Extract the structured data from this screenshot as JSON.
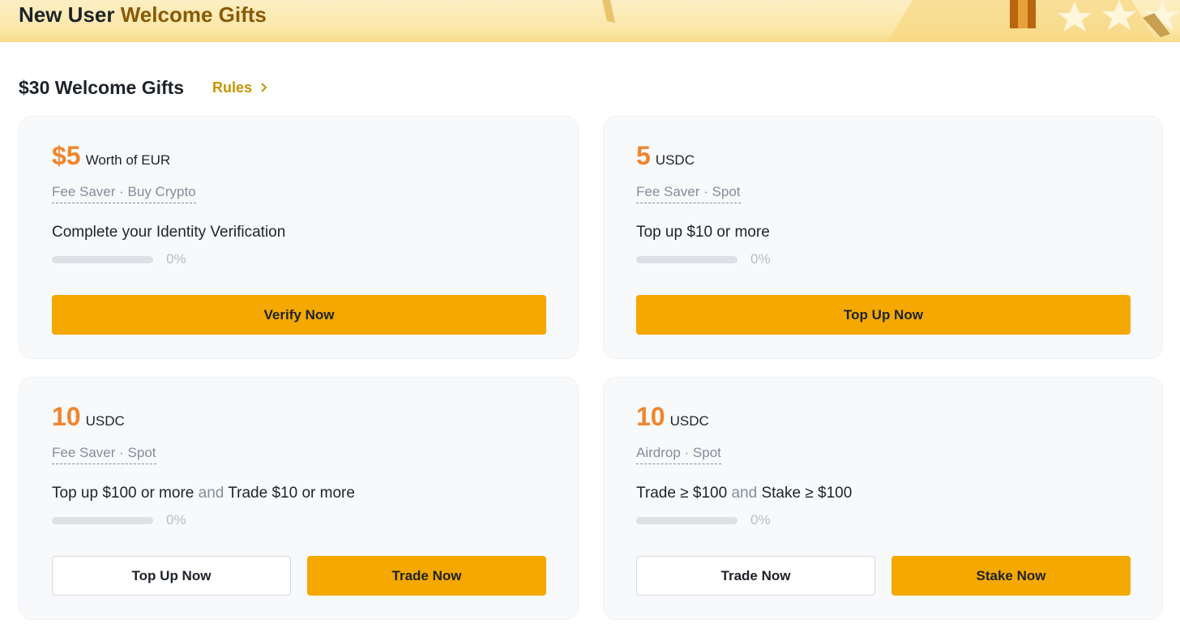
{
  "banner": {
    "title_prefix": "New User",
    "title_accent": "Welcome Gifts"
  },
  "section": {
    "title": "$30 Welcome Gifts",
    "rules_label": "Rules"
  },
  "cards": [
    {
      "amount": "$5",
      "unit": "Worth of EUR",
      "tags": "Fee Saver · Buy Crypto",
      "task_parts": [
        "Complete your Identity Verification"
      ],
      "progress_fraction": 0,
      "progress_label": "0%",
      "buttons": [
        {
          "label": "Verify Now",
          "style": "primary"
        }
      ]
    },
    {
      "amount": "5",
      "unit": "USDC",
      "tags": "Fee Saver · Spot",
      "task_parts": [
        "Top up $10 or more"
      ],
      "progress_fraction": 0,
      "progress_label": "0%",
      "buttons": [
        {
          "label": "Top Up Now",
          "style": "primary"
        }
      ]
    },
    {
      "amount": "10",
      "unit": "USDC",
      "tags": "Fee Saver · Spot",
      "task_parts": [
        "Top up $100 or more",
        "and",
        "Trade $10 or more"
      ],
      "progress_fraction": 0,
      "progress_label": "0%",
      "buttons": [
        {
          "label": "Top Up Now",
          "style": "secondary"
        },
        {
          "label": "Trade Now",
          "style": "primary"
        }
      ]
    },
    {
      "amount": "10",
      "unit": "USDC",
      "tags": "Airdrop · Spot",
      "task_parts": [
        "Trade ≥ $100",
        "and",
        "Stake ≥ $100"
      ],
      "progress_fraction": 0,
      "progress_label": "0%",
      "buttons": [
        {
          "label": "Trade Now",
          "style": "secondary"
        },
        {
          "label": "Stake Now",
          "style": "primary"
        }
      ]
    }
  ],
  "colors": {
    "accent_orange": "#f0852d",
    "button_yellow": "#f5a800",
    "rules_gold": "#c99400",
    "banner_gold": "#8a5a07"
  }
}
